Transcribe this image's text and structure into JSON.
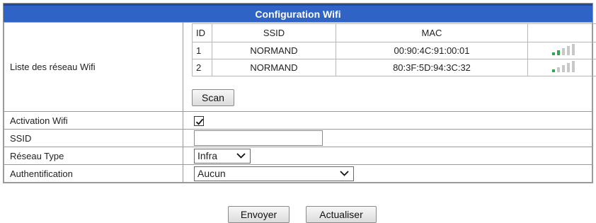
{
  "header": {
    "title": "Configuration Wifi"
  },
  "wifi_list": {
    "label": "Liste des réseau Wifi",
    "columns": [
      "ID",
      "SSID",
      "MAC",
      ""
    ],
    "rows": [
      {
        "id": "1",
        "ssid": "NORMAND",
        "mac": "00:90:4C:91:00:01",
        "signal": 2
      },
      {
        "id": "2",
        "ssid": "NORMAND",
        "mac": "80:3F:5D:94:3C:32",
        "signal": 1
      }
    ],
    "scan_label": "Scan"
  },
  "fields": {
    "activation": {
      "label": "Activation Wifi",
      "checked": true
    },
    "ssid": {
      "label": "SSID",
      "value": ""
    },
    "network_type": {
      "label": "Réseau Type",
      "value": "Infra"
    },
    "auth": {
      "label": "Authentification",
      "value": "Aucun"
    }
  },
  "actions": {
    "send_label": "Envoyer",
    "refresh_label": "Actualiser"
  },
  "colors": {
    "header_bg": "#2f63c6",
    "signal_on": "#2ea84a",
    "signal_off": "#c8c8c8"
  },
  "icons": {
    "checkbox": "checkmark-icon",
    "dropdown": "chevron-down-icon",
    "signal": "signal-bars-icon"
  }
}
